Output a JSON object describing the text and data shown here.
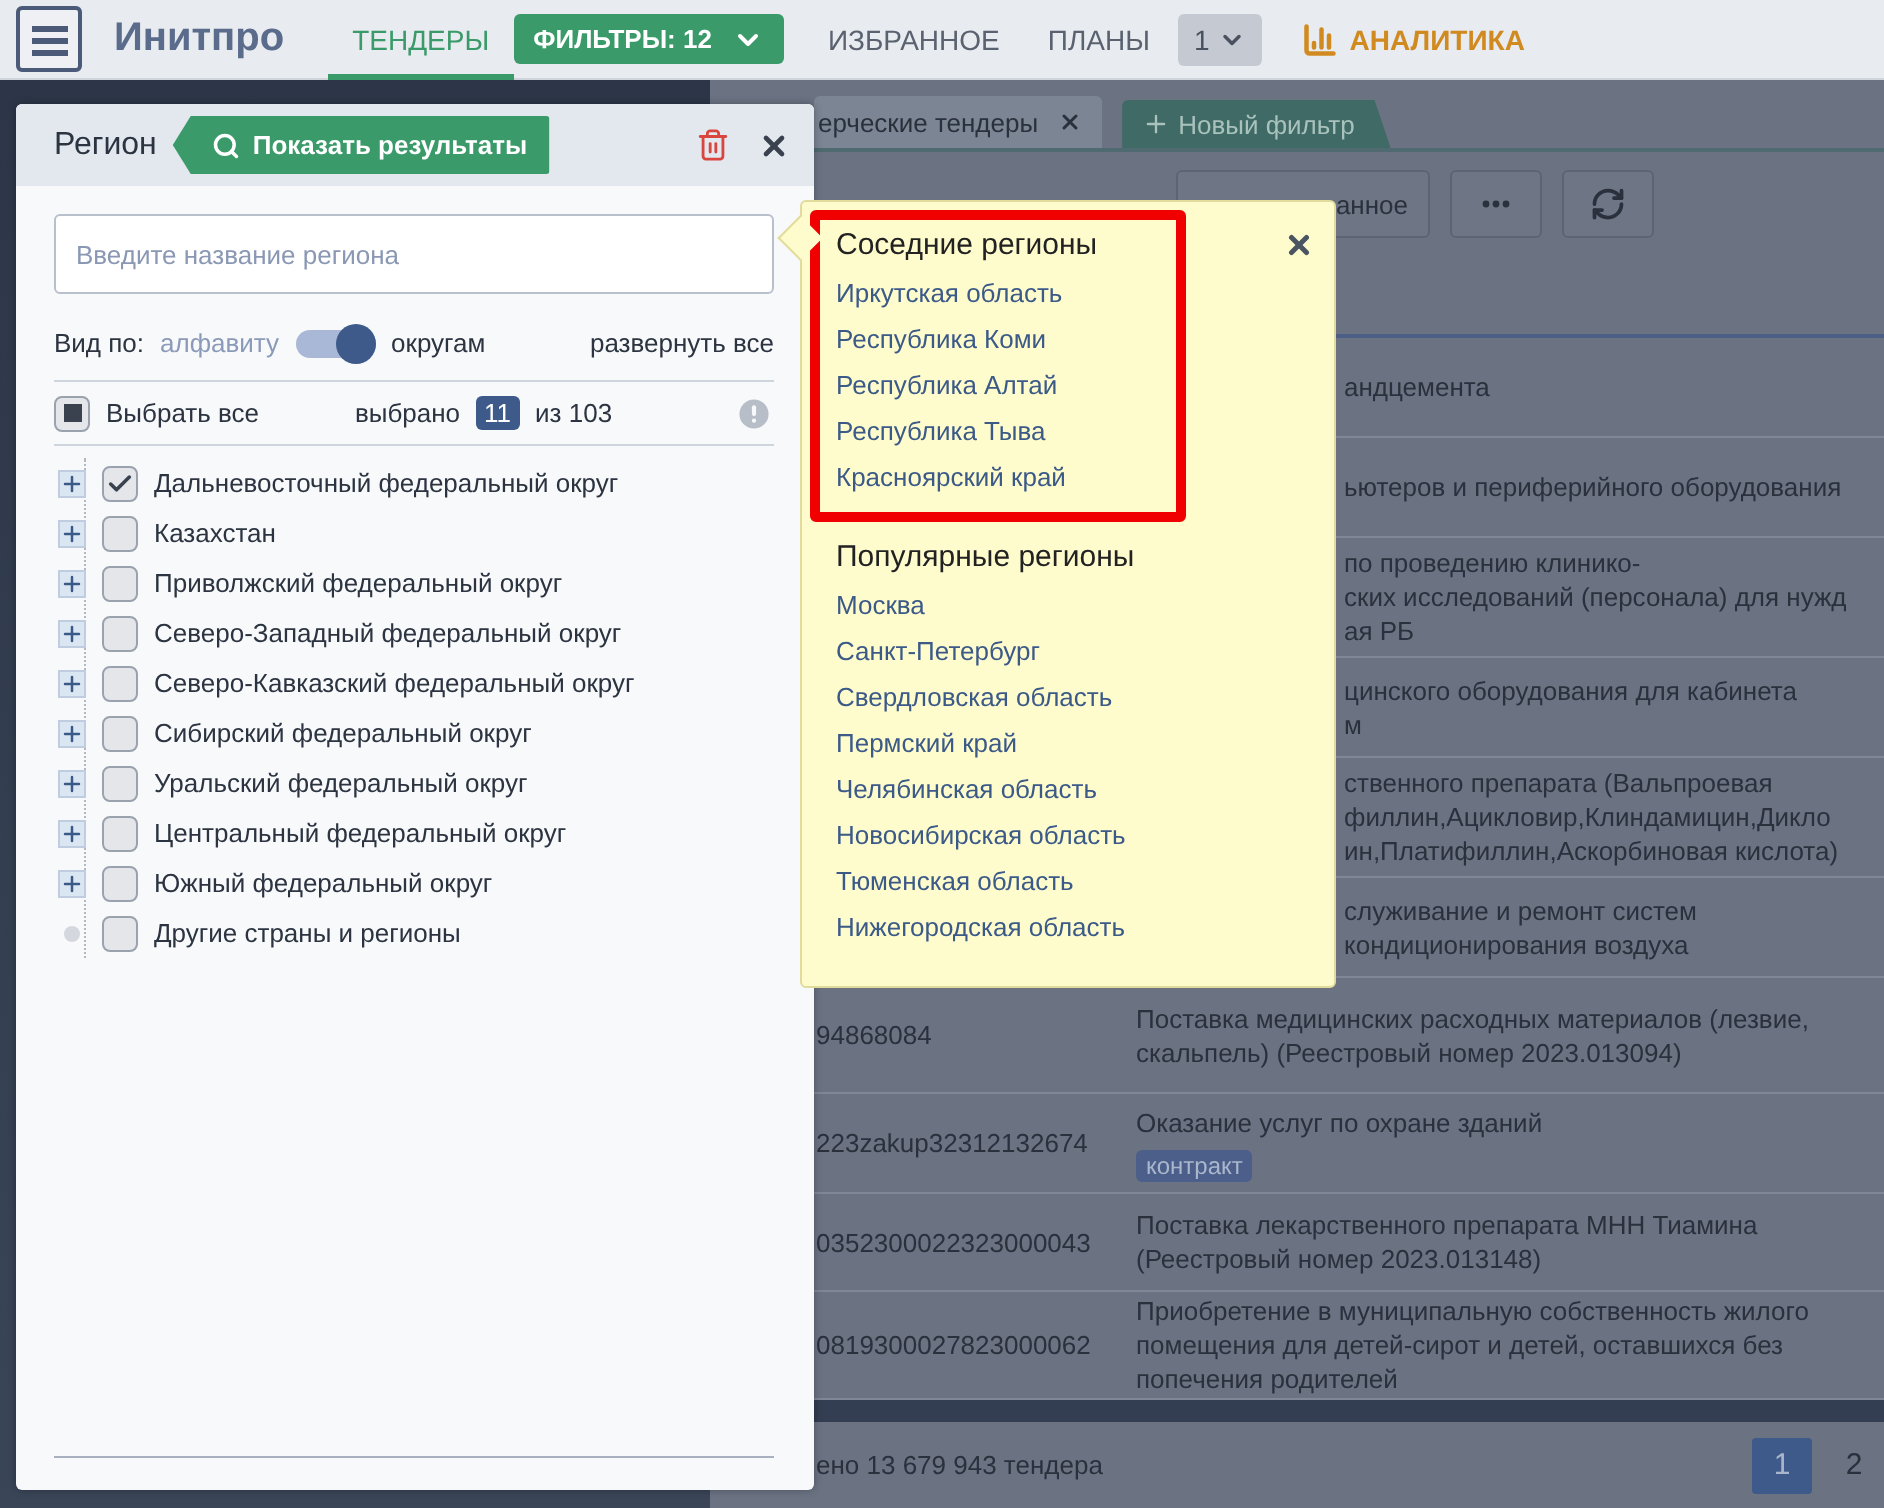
{
  "topbar": {
    "brand": "Инитпро",
    "items": [
      {
        "kind": "tab",
        "label": "ТЕНДЕРЫ",
        "selected": true
      },
      {
        "kind": "dropdown",
        "label": "ФИЛЬТРЫ: 12"
      },
      {
        "kind": "tab",
        "label": "ИЗБРАННОЕ",
        "selected": false
      },
      {
        "kind": "tab",
        "label": "ПЛАНЫ",
        "selected": false
      },
      {
        "kind": "select",
        "label": "1"
      },
      {
        "kind": "analytics",
        "label": "АНАЛИТИКА"
      }
    ]
  },
  "filter_tabs": [
    {
      "kind": "filter",
      "label": "ерческие тендеры",
      "selected": true
    },
    {
      "kind": "new",
      "label": "Новый фильтр",
      "selected": false
    }
  ],
  "toolbar": [
    {
      "kind": "text",
      "label": "анное"
    },
    {
      "kind": "more"
    },
    {
      "kind": "refresh"
    }
  ],
  "table": {
    "rows": [
      {
        "lines": [
          "андцемента"
        ]
      },
      {
        "lines": [
          "ьютеров и периферийного оборудования"
        ]
      },
      {
        "lines": [
          "по проведению клинико-",
          "ских исследований (персонала) для нужд",
          "ая РБ"
        ]
      },
      {
        "lines": [
          "цинского оборудования для кабинета",
          "м"
        ]
      },
      {
        "lines": [
          "ственного препарата (Вальпроевая",
          "филлин,Ацикловир,Клиндамицин,Дикло",
          "ин,Платифиллин,Аскорбиновая кислота)"
        ]
      },
      {
        "lines": [
          "служивание и ремонт систем",
          "кондиционирования воздуха"
        ]
      },
      {
        "number": "94868084",
        "lines": [
          "Поставка медицинских расходных материалов (лезвие,",
          "скальпель) (Реестровый номер 2023.013094)"
        ]
      },
      {
        "number": "223zakup32312132674",
        "lines": [
          "Оказание услуг по охране зданий"
        ],
        "tag": "контракт"
      },
      {
        "number": "0352300022323000043",
        "lines": [
          "Поставка лекарственного препарата МНН Тиамина",
          "(Реестровый номер 2023.013148)"
        ]
      },
      {
        "number": "0819300027823000062",
        "lines": [
          "Приобретение в муниципальную собственность жилого",
          "помещения для детей-сирот и детей, оставшихся без",
          "попечения родителей"
        ]
      }
    ]
  },
  "footer": {
    "total": "ено 13 679 943 тендера",
    "pages": [
      {
        "label": "1",
        "selected": true
      },
      {
        "label": "2",
        "selected": false
      }
    ]
  },
  "region_panel": {
    "title": "Регион",
    "show_results": "Показать результаты",
    "search": {
      "placeholder": "Введите название региона"
    },
    "view_by": {
      "label": "Вид по:",
      "options": [
        {
          "label": "алфавиту",
          "selected": false
        },
        {
          "label": "округам",
          "selected": true
        }
      ],
      "expand_all": "развернуть все"
    },
    "select_all": {
      "label": "Выбрать все",
      "indeterminate": true
    },
    "selected_count": {
      "prefix": "выбрано",
      "count": "11",
      "suffix": "из 103"
    },
    "tree": [
      {
        "kind": "group",
        "label": "Дальневосточный федеральный округ",
        "checked": true
      },
      {
        "kind": "group",
        "label": "Казахстан",
        "checked": false
      },
      {
        "kind": "group",
        "label": "Приволжский федеральный округ",
        "checked": false
      },
      {
        "kind": "group",
        "label": "Северо-Западный федеральный округ",
        "checked": false
      },
      {
        "kind": "group",
        "label": "Северо-Кавказский федеральный округ",
        "checked": false
      },
      {
        "kind": "group",
        "label": "Сибирский федеральный округ",
        "checked": false
      },
      {
        "kind": "group",
        "label": "Уральский федеральный округ",
        "checked": false
      },
      {
        "kind": "group",
        "label": "Центральный федеральный округ",
        "checked": false
      },
      {
        "kind": "group",
        "label": "Южный федеральный округ",
        "checked": false
      },
      {
        "kind": "leaf",
        "label": "Другие страны и регионы",
        "checked": false
      }
    ]
  },
  "suggestions": {
    "sections": [
      {
        "title": "Соседние регионы",
        "highlighted": true,
        "links": [
          "Иркутская область",
          "Республика Коми",
          "Республика Алтай",
          "Республика Тыва",
          "Красноярский край"
        ]
      },
      {
        "title": "Популярные регионы",
        "highlighted": false,
        "links": [
          "Москва",
          "Санкт-Петербург",
          "Свердловская область",
          "Пермский край",
          "Челябинская область",
          "Новосибирская область",
          "Тюменская область",
          "Нижегородская область"
        ]
      }
    ]
  }
}
